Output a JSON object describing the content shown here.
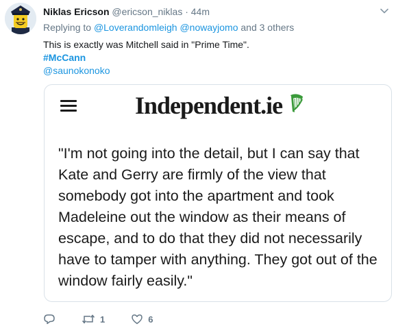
{
  "tweet": {
    "display_name": "Niklas Ericson",
    "handle": "@ericson_niklas",
    "separator": "·",
    "time": "44m",
    "reply": {
      "prefix": "Replying to",
      "mention1": "@Loverandomleigh",
      "mention2": "@nowayjomo",
      "suffix": "and 3 others"
    },
    "text": "This is exactly was Mitchell said in \"Prime Time\".",
    "hashtag": "#McCann",
    "mention": "@saunokonoko"
  },
  "card": {
    "logo_text": "Independent.ie",
    "logo_icon": "harp-icon",
    "menu_icon": "hamburger-icon",
    "quote": "\"I'm not going into the detail, but I can say that Kate and Gerry are firmly of the view that somebody got into the apartment and took Madeleine out the window as their means of escape, and to do that they did not necessarily have to tamper with anything. They got out of the window fairly easily.\""
  },
  "actions": {
    "reply_icon": "reply-icon",
    "retweet_icon": "retweet-icon",
    "retweet_count": "1",
    "like_icon": "heart-icon",
    "like_count": "6"
  },
  "colors": {
    "link": "#1b95e0",
    "muted": "#657786",
    "harp_green": "#3a9a3a"
  }
}
